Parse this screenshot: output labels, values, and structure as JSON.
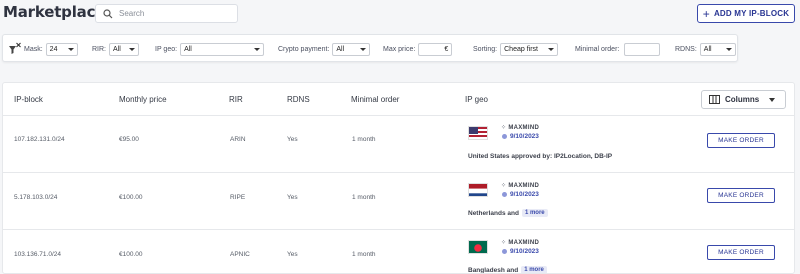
{
  "header": {
    "title": "Marketplace",
    "search_placeholder": "Search",
    "add_button": "ADD MY IP-BLOCK"
  },
  "filters": {
    "mask_label": "Mask:",
    "mask_value": "24",
    "rir_label": "RIR:",
    "rir_value": "All",
    "ipgeo_label": "IP geo:",
    "ipgeo_value": "All",
    "crypto_label": "Crypto payment:",
    "crypto_value": "All",
    "maxprice_label": "Max price:",
    "maxprice_currency": "€",
    "sorting_label": "Sorting:",
    "sorting_value": "Cheap first",
    "minorder_label": "Minimal order:",
    "rdns_label": "RDNS:",
    "rdns_value": "All"
  },
  "table": {
    "headers": {
      "ipblock": "IP-block",
      "price": "Monthly price",
      "rir": "RIR",
      "rdns": "RDNS",
      "minorder": "Minimal order",
      "ipgeo": "IP geo"
    },
    "columns_button": "Columns",
    "provider": "MAXMIND",
    "order_button": "MAKE ORDER",
    "rows": [
      {
        "ip": "107.182.131.0/24",
        "price": "€95.00",
        "rir": "ARIN",
        "rdns": "Yes",
        "minorder": "1 month",
        "date": "9/10/2023",
        "geo": "United States approved by: IP2Location, DB-IP",
        "more": "",
        "flag": "us"
      },
      {
        "ip": "5.178.103.0/24",
        "price": "€100.00",
        "rir": "RIPE",
        "rdns": "Yes",
        "minorder": "1 month",
        "date": "9/10/2023",
        "geo": "Netherlands and",
        "more": "1 more",
        "flag": "nl"
      },
      {
        "ip": "103.136.71.0/24",
        "price": "€100.00",
        "rir": "APNIC",
        "rdns": "Yes",
        "minorder": "1 month",
        "date": "9/10/2023",
        "geo": "Bangladesh and",
        "more": "1 more",
        "flag": "bd"
      }
    ]
  }
}
